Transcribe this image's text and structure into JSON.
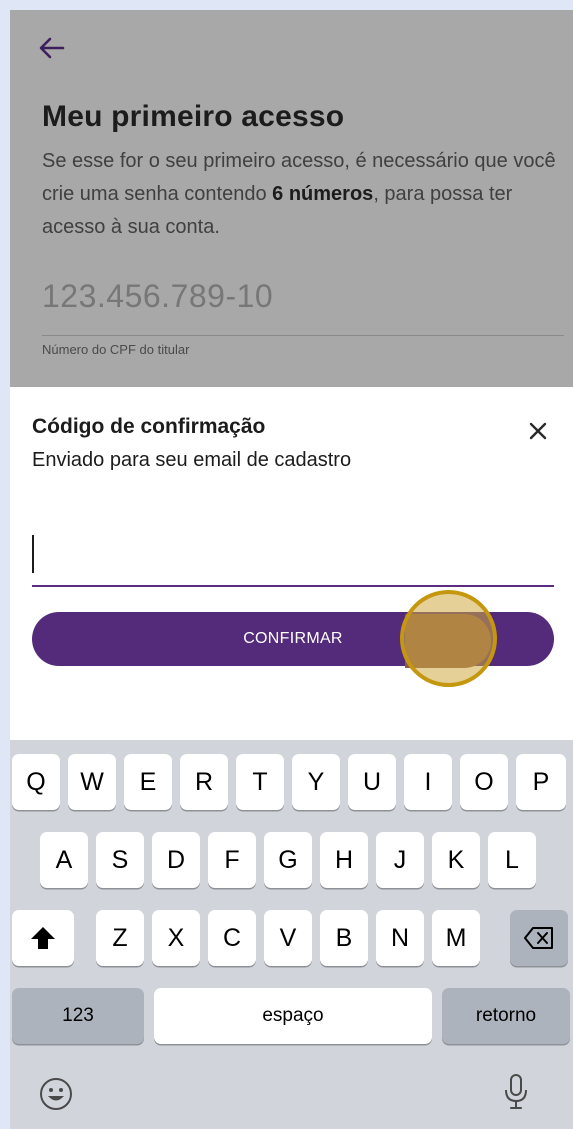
{
  "page": {
    "title": "Meu primeiro acesso",
    "desc_part1": "Se esse for o seu primeiro acesso, é necessário que você crie uma senha contendo ",
    "desc_bold": "6 números",
    "desc_part2": ", para possa ter acesso à sua conta.",
    "cpf_value": "123.456.789-10",
    "cpf_label": "Número do CPF do titular",
    "back_icon": "arrow-left-icon"
  },
  "sheet": {
    "title": "Código de confirmação",
    "subtitle": "Enviado para seu email de cadastro",
    "code_value": "",
    "confirm_label": "CONFIRMAR",
    "close_icon": "close-icon"
  },
  "keyboard": {
    "row1": [
      "Q",
      "W",
      "E",
      "R",
      "T",
      "Y",
      "U",
      "I",
      "O",
      "P"
    ],
    "row2": [
      "A",
      "S",
      "D",
      "F",
      "G",
      "H",
      "J",
      "K",
      "L"
    ],
    "row3": [
      "Z",
      "X",
      "C",
      "V",
      "B",
      "N",
      "M"
    ],
    "numbers_label": "123",
    "space_label": "espaço",
    "return_label": "retorno",
    "shift_icon": "shift-icon",
    "delete_icon": "backspace-icon",
    "emoji_icon": "emoji-icon",
    "mic_icon": "microphone-icon"
  },
  "colors": {
    "accent": "#532b7a",
    "overlay": "#a8a8a8",
    "frame": "#dfe6f5",
    "touch_marker": "#c4970e"
  }
}
